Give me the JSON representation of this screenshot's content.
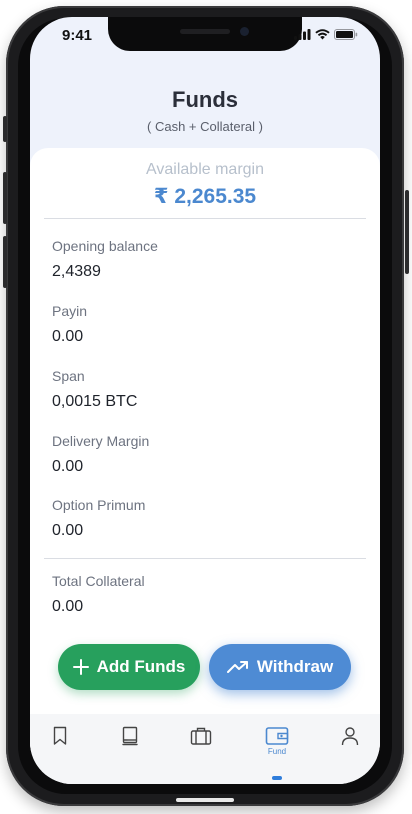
{
  "status_bar": {
    "time": "9:41"
  },
  "header": {
    "title": "Funds",
    "subtitle": "( Cash + Collateral )"
  },
  "available_margin": {
    "label": "Available margin",
    "value": "₹ 2,265.35"
  },
  "fields": [
    {
      "label": "Opening balance",
      "value": "2,4389"
    },
    {
      "label": "Payin",
      "value": "0.00"
    },
    {
      "label": "Span",
      "value": "0,0015 BTC"
    },
    {
      "label": "Delivery Margin",
      "value": "0.00"
    },
    {
      "label": "Option Primum",
      "value": "0.00"
    },
    {
      "label": "Total Collateral",
      "value": "0.00"
    }
  ],
  "actions": {
    "add_funds": "Add Funds",
    "withdraw": "Withdraw"
  },
  "tabbar": {
    "items": [
      {
        "icon": "bookmark-icon"
      },
      {
        "icon": "book-icon"
      },
      {
        "icon": "briefcase-icon"
      },
      {
        "icon": "wallet-icon",
        "label": "Fund",
        "active": true
      },
      {
        "icon": "profile-icon"
      }
    ]
  },
  "colors": {
    "accent": "#4b88cf",
    "add_funds": "#27a05d",
    "withdraw": "#4e8bd4"
  }
}
